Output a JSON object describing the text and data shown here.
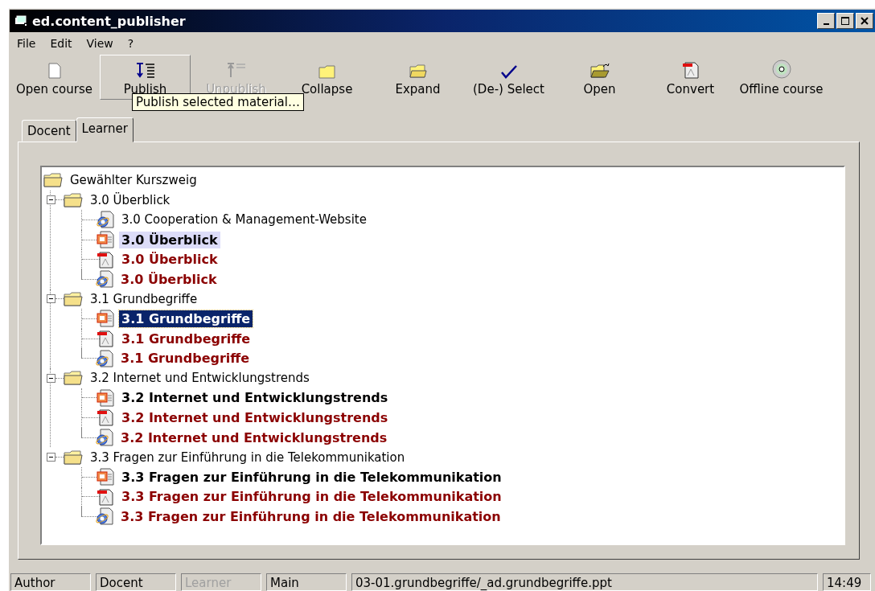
{
  "window": {
    "title": "ed.content_publisher"
  },
  "menu": [
    "File",
    "Edit",
    "View",
    "?"
  ],
  "toolbar": [
    {
      "label": "Open course",
      "kind": "page",
      "disabled": false,
      "hovered": false
    },
    {
      "label": "Publish",
      "kind": "publish",
      "disabled": false,
      "hovered": true
    },
    {
      "label": "Unpublish",
      "kind": "unpublish",
      "disabled": true,
      "hovered": false
    },
    {
      "label": "Collapse",
      "kind": "folder",
      "disabled": false,
      "hovered": false
    },
    {
      "label": "Expand",
      "kind": "folder-open",
      "disabled": false,
      "hovered": false
    },
    {
      "label": "(De-) Select",
      "kind": "check",
      "disabled": false,
      "hovered": false
    },
    {
      "label": "Open",
      "kind": "open",
      "disabled": false,
      "hovered": false
    },
    {
      "label": "Convert",
      "kind": "pdf",
      "disabled": false,
      "hovered": false
    },
    {
      "label": "Offline course",
      "kind": "disc",
      "disabled": false,
      "hovered": false
    }
  ],
  "tooltip": "Publish selected material…",
  "tabs": [
    {
      "label": "Docent",
      "selected": false
    },
    {
      "label": "Learner",
      "selected": true
    }
  ],
  "tree": {
    "label": "Gewählter Kurszweig",
    "children": [
      {
        "label": "3.0 Überblick",
        "expanded": true,
        "children": [
          {
            "label": "3.0 Cooperation & Management-Website",
            "kind": "web",
            "marked": false,
            "published": false,
            "selected": false,
            "highlighted": false
          },
          {
            "label": "3.0 Überblick",
            "kind": "ppt",
            "marked": true,
            "published": false,
            "selected": false,
            "highlighted": true
          },
          {
            "label": "3.0 Überblick",
            "kind": "pdf",
            "marked": true,
            "published": true,
            "selected": false,
            "highlighted": false
          },
          {
            "label": "3.0 Überblick",
            "kind": "web",
            "marked": true,
            "published": true,
            "selected": false,
            "highlighted": false
          }
        ]
      },
      {
        "label": "3.1 Grundbegriffe",
        "expanded": true,
        "children": [
          {
            "label": "3.1 Grundbegriffe",
            "kind": "ppt",
            "marked": true,
            "published": false,
            "selected": true,
            "highlighted": false
          },
          {
            "label": "3.1 Grundbegriffe",
            "kind": "pdf",
            "marked": true,
            "published": true,
            "selected": false,
            "highlighted": false
          },
          {
            "label": "3.1 Grundbegriffe",
            "kind": "web",
            "marked": true,
            "published": true,
            "selected": false,
            "highlighted": false
          }
        ]
      },
      {
        "label": "3.2 Internet und Entwicklungstrends",
        "expanded": true,
        "children": [
          {
            "label": "3.2 Internet und Entwicklungstrends",
            "kind": "ppt",
            "marked": true,
            "published": false,
            "selected": false,
            "highlighted": false
          },
          {
            "label": "3.2 Internet und Entwicklungstrends",
            "kind": "pdf",
            "marked": true,
            "published": true,
            "selected": false,
            "highlighted": false
          },
          {
            "label": "3.2 Internet und Entwicklungstrends",
            "kind": "web",
            "marked": true,
            "published": true,
            "selected": false,
            "highlighted": false
          }
        ]
      },
      {
        "label": "3.3 Fragen zur Einführung in die Telekommunikation",
        "expanded": true,
        "children": [
          {
            "label": "3.3 Fragen zur Einführung in die Telekommunikation",
            "kind": "ppt",
            "marked": true,
            "published": false,
            "selected": false,
            "highlighted": false
          },
          {
            "label": "3.3 Fragen zur Einführung in die Telekommunikation",
            "kind": "pdf",
            "marked": true,
            "published": true,
            "selected": false,
            "highlighted": false
          },
          {
            "label": "3.3 Fragen zur Einführung in die Telekommunikation",
            "kind": "web",
            "marked": true,
            "published": true,
            "selected": false,
            "highlighted": false
          }
        ]
      }
    ]
  },
  "status_bar": [
    {
      "text": "Author",
      "disabled": false
    },
    {
      "text": "Docent",
      "disabled": false
    },
    {
      "text": "Learner",
      "disabled": true
    },
    {
      "text": "Main",
      "disabled": false
    },
    {
      "text": "03-01.grundbegriffe/_ad.grundbegriffe.ppt",
      "disabled": false
    },
    {
      "text": "14:49",
      "disabled": false
    }
  ]
}
